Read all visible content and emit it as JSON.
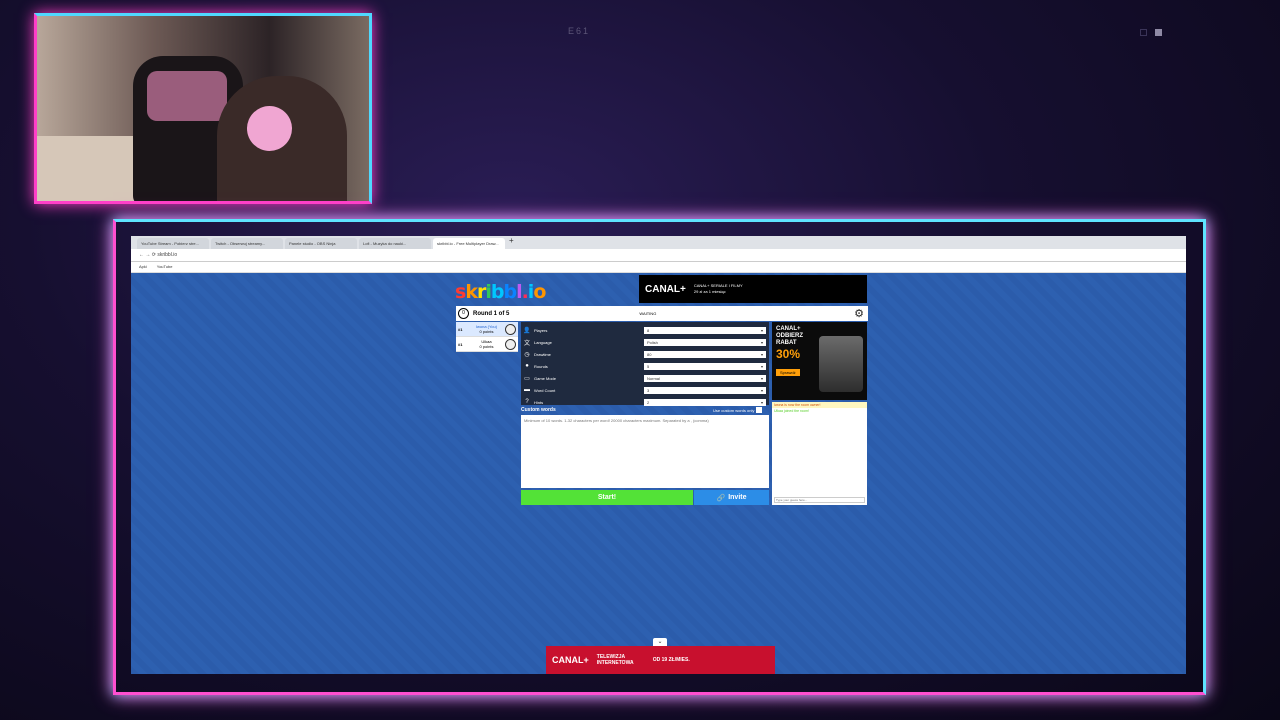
{
  "overlay": {
    "label": "E61"
  },
  "browser": {
    "tabs": [
      "YouTube Stream - Pobierz stre...",
      "Twitch - Obserwuj streamy...",
      "Panele studio - OBS Ninja",
      "Lofi - Muzyka do nauki...",
      "skribbl.io - Free Multiplayer Draw..."
    ],
    "tab_plus": "+",
    "url": "skribbl.io",
    "bookmarks": [
      "Apki",
      "YouTube"
    ]
  },
  "game": {
    "round_text": "Round 1 of 5",
    "clock_value": "0",
    "status": "WAITING",
    "players": [
      {
        "rank": "#1",
        "name": "Iwona (You)",
        "points": "0 points"
      },
      {
        "rank": "#1",
        "name": "Ulkaa",
        "points": "0 points"
      }
    ],
    "settings": [
      {
        "label": "Players",
        "value": "8"
      },
      {
        "label": "Language",
        "value": "Polish"
      },
      {
        "label": "Drawtime",
        "value": "80"
      },
      {
        "label": "Rounds",
        "value": "5"
      },
      {
        "label": "Game Mode",
        "value": "Normal"
      },
      {
        "label": "Word Count",
        "value": "3"
      },
      {
        "label": "Hints",
        "value": "2"
      }
    ],
    "custom_words_label": "Custom words",
    "custom_only_label": "Use custom words only",
    "custom_words_placeholder": "Minimum of 10 words. 1-32 characters per word! 20000 characters maximum. Separated by a , (comma)",
    "start_label": "Start!",
    "invite_label": "Invite",
    "chat": [
      {
        "text": "Iwona is now the room owner!",
        "kind": "owner"
      },
      {
        "text": "Ulkaa joined the room!",
        "kind": "join"
      }
    ],
    "chat_placeholder": "Type your guess here..."
  },
  "ads": {
    "top_brand": "CANAL+",
    "top_text": "CANAL+ SERIALE I FILMY",
    "top_sub": "29 zł za 1 miesiąc",
    "side_title": "CANAL+ ODBIERZ RABAT",
    "side_pct": "30%",
    "side_button": "Sprawdź",
    "bottom_brand": "CANAL+",
    "bottom_text": "TELEWIZJA INTERNETOWA",
    "bottom_price": "OD 19 ZŁ/MIES."
  }
}
